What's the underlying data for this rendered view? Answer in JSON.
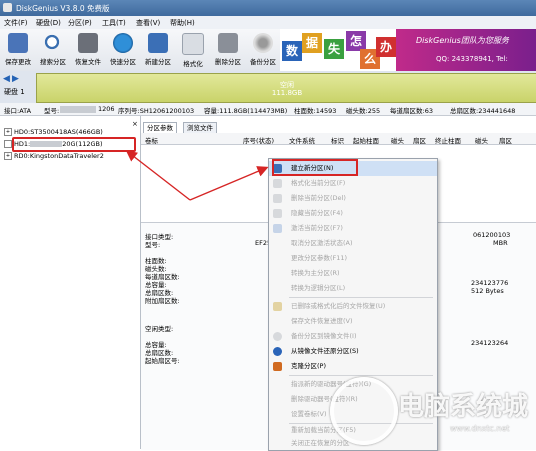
{
  "window": {
    "title": "DiskGenius V3.8.0 免费版"
  },
  "menu": [
    "文件(F)",
    "硬盘(D)",
    "分区(P)",
    "工具(T)",
    "查看(V)",
    "帮助(H)"
  ],
  "toolbar": [
    "保存更改",
    "搜索分区",
    "恢复文件",
    "快速分区",
    "新建分区",
    "格式化",
    "删除分区",
    "备份分区"
  ],
  "banner": {
    "chars": [
      "数",
      "据",
      "失",
      "怎",
      "么",
      "办"
    ],
    "brand": "DiskGenius团队为您服务",
    "phone": "QQ: 243378941, Tel:"
  },
  "disk_bar": {
    "label": "硬盘 1",
    "partition_name": "空闲",
    "partition_size": "111.8GB"
  },
  "info_bar": [
    "接口:ATA",
    "型号:",
    "1206",
    "序列号:SH12061200103",
    "容量:111.8GB(114473MB)",
    "柱面数:14593",
    "磁头数:255",
    "每道扇区数:63",
    "总扇区数:234441648"
  ],
  "tree": {
    "hd0": "HD0:ST3500418AS(466GB)",
    "hd1": "HD1:",
    "hd1_suffix": "20G(112GB)",
    "rd": "RD0:KingstonDataTraveler2"
  },
  "tabs": [
    "分区参数",
    "浏览文件"
  ],
  "columns": [
    "卷标",
    "序号(状态)",
    "文件系统",
    "标识",
    "起始柱面",
    "磁头",
    "扇区",
    "终止柱面",
    "磁头",
    "扇区"
  ],
  "details": {
    "labels1": [
      "接口类型:",
      "型号:"
    ],
    "labels2": [
      "柱面数:",
      "磁头数:",
      "每道扇区数:",
      "总容量:",
      "总扇区数:",
      "附加扇区数:"
    ],
    "labels3": [
      "空闲类型:",
      "总容量:",
      "总扇区数:",
      "起始扇区号:"
    ],
    "val_model": "EF250",
    "val_serial": "061200103",
    "val_mbr": "MBR",
    "val_sectors": "234123776",
    "val_bytes": "512 Bytes",
    "val_free_sectors": "234123264",
    "val_s1": "S",
    "val_s2": "S"
  },
  "context_menu": [
    {
      "label": "建立新分区(N)",
      "enabled": true,
      "icon": "new-partition-icon"
    },
    {
      "label": "格式化当前分区(F)",
      "enabled": false,
      "icon": "format-icon"
    },
    {
      "label": "删除当前分区(Del)",
      "enabled": false,
      "icon": "delete-icon"
    },
    {
      "label": "隐藏当前分区(F4)",
      "enabled": false,
      "icon": "hide-icon"
    },
    {
      "label": "激活当前分区(F7)",
      "enabled": false,
      "icon": "activate-icon"
    },
    {
      "label": "取消分区激活状态(A)",
      "enabled": false,
      "icon": ""
    },
    {
      "label": "更改分区参数(F11)",
      "enabled": false,
      "icon": ""
    },
    {
      "label": "转换为主分区(R)",
      "enabled": false,
      "icon": ""
    },
    {
      "label": "转换为逻辑分区(L)",
      "enabled": false,
      "icon": ""
    },
    {
      "label": "已删除或格式化后的文件恢复(U)",
      "enabled": false,
      "icon": "recover-icon"
    },
    {
      "label": "保存文件恢复进度(V)",
      "enabled": false,
      "icon": ""
    },
    {
      "label": "备份分区到镜像文件(I)",
      "enabled": false,
      "icon": "backup-icon"
    },
    {
      "label": "从镜像文件还原分区(S)",
      "enabled": true,
      "icon": "restore-icon"
    },
    {
      "label": "克隆分区(P)",
      "enabled": true,
      "icon": "clone-icon"
    },
    {
      "label": "指派新的驱动器号(盘符)(G)",
      "enabled": false,
      "icon": ""
    },
    {
      "label": "删除驱动器号(盘符)(R)",
      "enabled": false,
      "icon": ""
    },
    {
      "label": "设置卷标(V)",
      "enabled": false,
      "icon": ""
    },
    {
      "label": "重新加载当前分区(F5)",
      "enabled": false,
      "icon": ""
    },
    {
      "label": "关闭正在恢复的分区",
      "enabled": false,
      "icon": ""
    }
  ],
  "watermark": {
    "text": "电脑系统城",
    "url": "www.dnxtc.net"
  },
  "colors": {
    "highlight": "#cfe0f5",
    "annotation_red": "#d62525",
    "partition_bar": "#c9d36a",
    "title_bar": "#3f6a9d"
  }
}
